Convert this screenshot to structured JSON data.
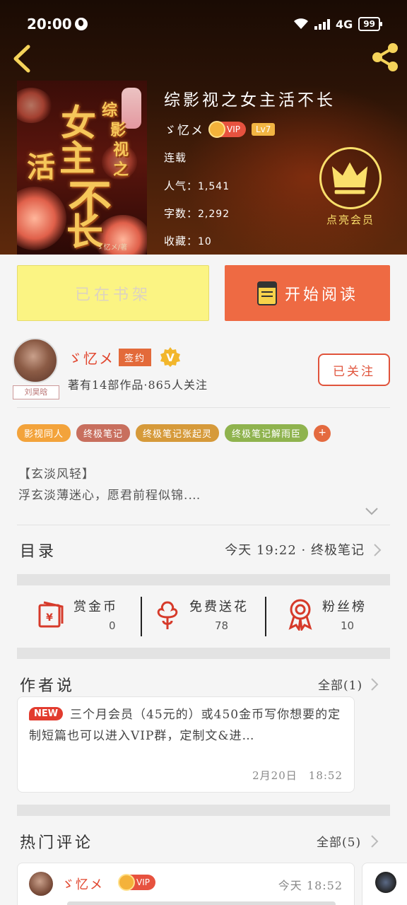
{
  "status_bar": {
    "time": "20:00",
    "network": "4G",
    "battery": "99"
  },
  "header": {
    "back_icon": "back-chevron-icon",
    "share_icon": "share-icon"
  },
  "book": {
    "title": "综影视之女主活不长",
    "cover": {
      "title_chars": [
        "综",
        "影",
        "视",
        "之",
        "女",
        "主",
        "活",
        "不",
        "长"
      ],
      "author": "ゞ忆メ/著"
    },
    "author": "ゞ忆メ",
    "vip": "VIP",
    "level": "Lv7",
    "status": "连载",
    "popularity_label": "人气：",
    "popularity": "1,541",
    "words_label": "字数：",
    "words": "2,292",
    "favorites_label": "收藏：",
    "favorites": "10",
    "member_label": "点亮会员"
  },
  "actions": {
    "shelf_label": "已在书架",
    "read_label": "开始阅读"
  },
  "author_card": {
    "name": "ゞ忆メ",
    "sign_badge": "签约",
    "v_badge": "V",
    "avatar_tag": "刘昊晗",
    "stats": "著有14部作品·865人关注",
    "follow_label": "已关注"
  },
  "tags": [
    {
      "label": "影视同人",
      "color": "#f3a33b"
    },
    {
      "label": "终极笔记",
      "color": "#c86f5e"
    },
    {
      "label": "终极笔记张起灵",
      "color": "#d69a3a"
    },
    {
      "label": "终极笔记解雨臣",
      "color": "#8fb34e"
    }
  ],
  "intro": {
    "line1": "【玄淡风轻】",
    "line2": "浮玄淡薄迷心，愿君前程似锦.…"
  },
  "catalog": {
    "title": "目录",
    "latest": "今天 19:22 · 终极笔记"
  },
  "support": [
    {
      "label": "赏金币",
      "count": "0",
      "icon": "red-envelope-icon"
    },
    {
      "label": "免费送花",
      "count": "78",
      "icon": "flower-icon"
    },
    {
      "label": "粉丝榜",
      "count": "10",
      "icon": "medal-icon"
    }
  ],
  "author_says": {
    "title": "作者说",
    "all": "全部(1)",
    "new_badge": "NEW",
    "text": "三个月会员（45元的）或450金币写你想要的定制短篇也可以进入VIP群，定制文&进…",
    "time": "2月20日　18:52"
  },
  "hot_comments": {
    "title": "热门评论",
    "all": "全部(5)",
    "first": {
      "name": "ゞ忆メ",
      "vip": "VIP",
      "time": "今天 18:52"
    }
  },
  "colors": {
    "accent": "#ee6a43",
    "shelf": "#fbf483",
    "author_red": "#e1462e",
    "gold": "#fadf6b"
  }
}
